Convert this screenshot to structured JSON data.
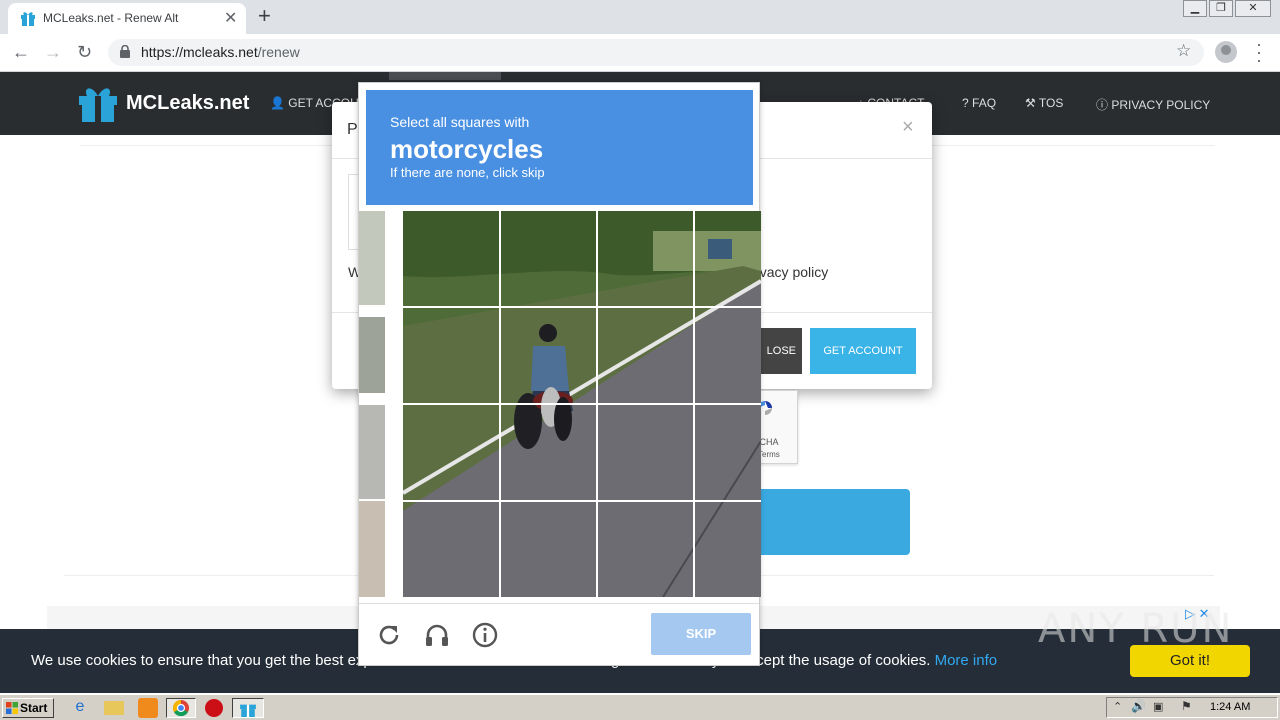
{
  "browser": {
    "tab_title": "MCLeaks.net - Renew Alt",
    "url_host": "https://mcleaks.net",
    "url_path": "/renew",
    "window_controls": [
      "minimize",
      "restore",
      "close"
    ]
  },
  "site": {
    "logo_text": "MCLeaks.net",
    "nav": {
      "get_account": "GET ACCOU",
      "contact": "CONTACT",
      "faq": "FAQ",
      "tos": "TOS",
      "privacy": "PRIVACY POLICY"
    }
  },
  "modal": {
    "title_fragment": "P",
    "body_fragment": "W",
    "policy_fragment": "rivacy policy",
    "close_button": "LOSE",
    "get_account_button": "GET ACCOUNT",
    "recaptcha_name": "TCHA",
    "recaptcha_terms": "Terms"
  },
  "captcha": {
    "instruction_pre": "Select all squares with",
    "target": "motorcycles",
    "instruction_post": "If there are none, click skip",
    "skip_label": "SKIP",
    "icons": [
      "reload-icon",
      "audio-icon",
      "info-icon"
    ]
  },
  "cookie_bar": {
    "text": "We use cookies to ensure that you get the best experience on MCLeaks. While browsing on MCLeaks you accept the usage of cookies.",
    "more_link": "More info",
    "button": "Got it!"
  },
  "watermark": "ANY RUN",
  "taskbar": {
    "start_label": "Start",
    "clock": "1:24 AM"
  },
  "colors": {
    "captcha_header": "#4a90e2",
    "skip_button": "#a4c8f0",
    "site_nav": "#2a2d30",
    "cookie_bar": "#252e38",
    "cookie_button": "#f1d600",
    "cookie_link": "#31a8f0",
    "get_account_button": "#3ab3e6"
  }
}
